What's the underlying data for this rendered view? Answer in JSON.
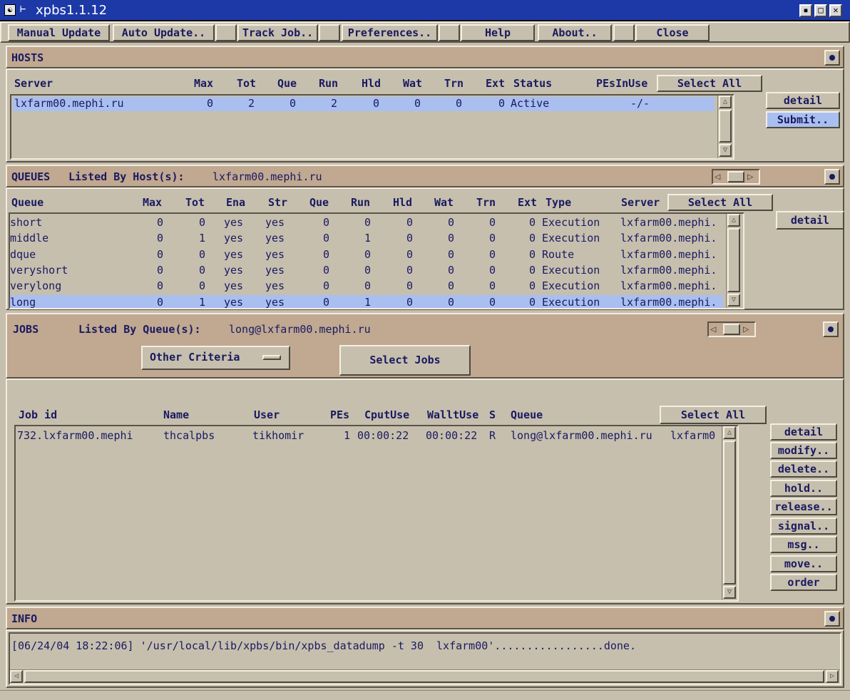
{
  "window": {
    "title": "xpbs1.1.12"
  },
  "menubar": {
    "manual_update": "Manual Update",
    "auto_update": "Auto Update..",
    "track_job": "Track Job..",
    "preferences": "Preferences..",
    "help": "Help",
    "about": "About..",
    "close": "Close"
  },
  "hosts": {
    "title": "HOSTS",
    "columns": [
      "Server",
      "Max",
      "Tot",
      "Que",
      "Run",
      "Hld",
      "Wat",
      "Trn",
      "Ext",
      "Status",
      "PEsInUse"
    ],
    "select_all": "Select All",
    "rows": [
      {
        "server": "lxfarm00.mephi.ru",
        "max": "0",
        "tot": "2",
        "que": "0",
        "run": "2",
        "hld": "0",
        "wat": "0",
        "trn": "0",
        "ext": "0",
        "status": "Active",
        "pes": "-/-"
      }
    ],
    "detail": "detail",
    "submit": "Submit.."
  },
  "queues": {
    "title": "QUEUES",
    "listed_by_label": "Listed By Host(s):",
    "listed_by_value": "lxfarm00.mephi.ru",
    "columns": [
      "Queue",
      "Max",
      "Tot",
      "Ena",
      "Str",
      "Que",
      "Run",
      "Hld",
      "Wat",
      "Trn",
      "Ext",
      "Type",
      "Server"
    ],
    "select_all": "Select All",
    "rows": [
      {
        "queue": "short",
        "max": "0",
        "tot": "0",
        "ena": "yes",
        "str": "yes",
        "que": "0",
        "run": "0",
        "hld": "0",
        "wat": "0",
        "trn": "0",
        "ext": "0",
        "type": "Execution",
        "server": "lxfarm00.mephi."
      },
      {
        "queue": "middle",
        "max": "0",
        "tot": "1",
        "ena": "yes",
        "str": "yes",
        "que": "0",
        "run": "1",
        "hld": "0",
        "wat": "0",
        "trn": "0",
        "ext": "0",
        "type": "Execution",
        "server": "lxfarm00.mephi."
      },
      {
        "queue": "dque",
        "max": "0",
        "tot": "0",
        "ena": "yes",
        "str": "yes",
        "que": "0",
        "run": "0",
        "hld": "0",
        "wat": "0",
        "trn": "0",
        "ext": "0",
        "type": "Route",
        "server": "lxfarm00.mephi."
      },
      {
        "queue": "veryshort",
        "max": "0",
        "tot": "0",
        "ena": "yes",
        "str": "yes",
        "que": "0",
        "run": "0",
        "hld": "0",
        "wat": "0",
        "trn": "0",
        "ext": "0",
        "type": "Execution",
        "server": "lxfarm00.mephi."
      },
      {
        "queue": "verylong",
        "max": "0",
        "tot": "0",
        "ena": "yes",
        "str": "yes",
        "que": "0",
        "run": "0",
        "hld": "0",
        "wat": "0",
        "trn": "0",
        "ext": "0",
        "type": "Execution",
        "server": "lxfarm00.mephi."
      },
      {
        "queue": "long",
        "max": "0",
        "tot": "1",
        "ena": "yes",
        "str": "yes",
        "que": "0",
        "run": "1",
        "hld": "0",
        "wat": "0",
        "trn": "0",
        "ext": "0",
        "type": "Execution",
        "server": "lxfarm00.mephi."
      }
    ],
    "detail": "detail"
  },
  "jobs": {
    "title": "JOBS",
    "listed_by_label": "Listed By Queue(s):",
    "listed_by_value": "long@lxfarm00.mephi.ru",
    "other_criteria": "Other Criteria",
    "select_jobs": "Select Jobs",
    "columns": [
      "Job id",
      "Name",
      "User",
      "PEs",
      "CputUse",
      "WalltUse",
      "S",
      "Queue"
    ],
    "select_all": "Select All",
    "rows": [
      {
        "jobid": "732.lxfarm00.mephi",
        "name": "thcalpbs",
        "user": "tikhomir",
        "pes": "1",
        "cput": "00:00:22",
        "wallt": "00:00:22",
        "s": "R",
        "queue": "long@lxfarm00.mephi.ru",
        "extra": "lxfarm0"
      }
    ],
    "actions": [
      "detail",
      "modify..",
      "delete..",
      "hold..",
      "release..",
      "signal..",
      "msg..",
      "move..",
      "order"
    ]
  },
  "info": {
    "title": "INFO",
    "log": "[06/24/04 18:22:06] '/usr/local/lib/xpbs/bin/xpbs_datadump -t 30  lxfarm00'.................done."
  }
}
